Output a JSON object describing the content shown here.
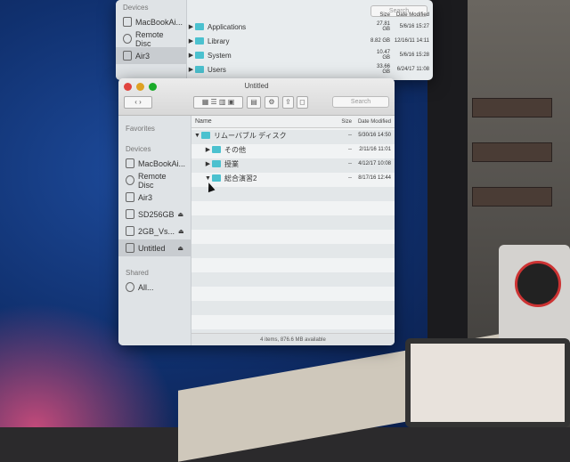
{
  "back_window": {
    "sidebar": {
      "devices_header": "Devices",
      "items": [
        {
          "label": "MacBookAi...",
          "icon": "laptop-icon"
        },
        {
          "label": "Remote Disc",
          "icon": "disc-icon"
        },
        {
          "label": "Air3",
          "icon": "drive-icon"
        }
      ]
    },
    "search_placeholder": "Search",
    "columns": {
      "size": "Size",
      "date": "Date Modified"
    },
    "rows": [
      {
        "name": "Applications",
        "size": "27.81 GB",
        "date": "5/6/16 15:27"
      },
      {
        "name": "Library",
        "size": "8.82 GB",
        "date": "12/16/11 14:11"
      },
      {
        "name": "System",
        "size": "10.47 GB",
        "date": "5/6/16 15:28"
      },
      {
        "name": "Users",
        "size": "33.66 GB",
        "date": "6/24/17 11:08"
      }
    ]
  },
  "front_window": {
    "title": "Untitled",
    "search_placeholder": "Search",
    "sidebar": {
      "favorites_header": "Favorites",
      "devices_header": "Devices",
      "shared_header": "Shared",
      "devices": [
        {
          "label": "MacBookAi...",
          "icon": "laptop-icon"
        },
        {
          "label": "Remote Disc",
          "icon": "disc-icon"
        },
        {
          "label": "Air3",
          "icon": "drive-icon"
        },
        {
          "label": "SD256GB",
          "icon": "drive-icon",
          "eject": "⏏"
        },
        {
          "label": "2GB_Vs...",
          "icon": "drive-icon",
          "eject": "⏏"
        },
        {
          "label": "Untitled",
          "icon": "drive-icon",
          "eject": "⏏",
          "selected": true
        }
      ],
      "shared": [
        {
          "label": "All...",
          "icon": "network-icon"
        }
      ]
    },
    "columns": {
      "name": "Name",
      "size": "Size",
      "date": "Date Modified"
    },
    "rows": [
      {
        "name": "リムーバブル ディスク",
        "level": 0,
        "expanded": true,
        "size": "--",
        "date": "5/30/16 14:50"
      },
      {
        "name": "その他",
        "level": 1,
        "expanded": false,
        "size": "--",
        "date": "2/11/16 11:01"
      },
      {
        "name": "授業",
        "level": 1,
        "expanded": false,
        "size": "--",
        "date": "4/12/17 10:08"
      },
      {
        "name": "総合演習2",
        "level": 1,
        "expanded": true,
        "size": "--",
        "date": "8/17/16 12:44"
      }
    ],
    "status": "4 items, 876.6 MB available"
  },
  "colors": {
    "folder": "#4bc1cf",
    "close": "#e0443e",
    "minimize": "#dea123",
    "zoom": "#1aab29"
  }
}
